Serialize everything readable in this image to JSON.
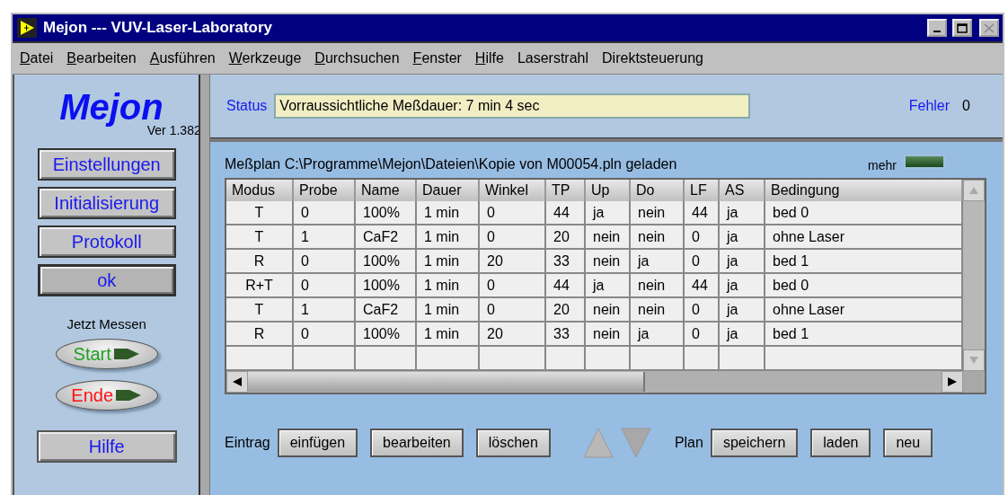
{
  "window": {
    "title": "Mejon --- VUV-Laser-Laboratory"
  },
  "menu": [
    {
      "label": "Datei",
      "mnemonic": true
    },
    {
      "label": "Bearbeiten",
      "mnemonic": true
    },
    {
      "label": "Ausführen",
      "mnemonic": true
    },
    {
      "label": "Werkzeuge",
      "mnemonic": true
    },
    {
      "label": "Durchsuchen",
      "mnemonic": true
    },
    {
      "label": "Fenster",
      "mnemonic": true
    },
    {
      "label": "Hilfe",
      "mnemonic": true
    },
    {
      "label": "Laserstrahl",
      "mnemonic": false
    },
    {
      "label": "Direktsteuerung",
      "mnemonic": false
    }
  ],
  "sidebar": {
    "logo": "Mejon",
    "version": "Ver 1.382",
    "buttons": [
      {
        "label": "Einstellungen",
        "pressed": false
      },
      {
        "label": "Initialisierung",
        "pressed": false
      },
      {
        "label": "Protokoll",
        "pressed": false
      },
      {
        "label": "ok",
        "pressed": true
      }
    ],
    "measure_label": "Jetzt Messen",
    "run_buttons": [
      {
        "label": "Start",
        "color": "#20a020"
      },
      {
        "label": "Ende",
        "color": "#ff1010"
      }
    ],
    "help_button": "Hilfe"
  },
  "status": {
    "label": "Status",
    "value": "Vorraussichtliche Meßdauer: 7 min 4 sec",
    "error_label": "Fehler",
    "error_value": "0"
  },
  "plan": {
    "caption": "Meßplan C:\\Programme\\Mejon\\Dateien\\Kopie von M00054.pln geladen",
    "more_label": "mehr",
    "more_on": false
  },
  "table": {
    "columns": [
      "Modus",
      "Probe",
      "Name",
      "Dauer",
      "Winkel",
      "TP",
      "Up",
      "Do",
      "LF",
      "AS",
      "Bedingung"
    ],
    "rows": [
      [
        "T",
        "0",
        "100%",
        "1 min",
        "0",
        "44",
        "ja",
        "nein",
        "44",
        "ja",
        "bed 0"
      ],
      [
        "T",
        "1",
        "CaF2",
        "1 min",
        "0",
        "20",
        "nein",
        "nein",
        "0",
        "ja",
        "ohne Laser"
      ],
      [
        "R",
        "0",
        "100%",
        "1 min",
        "20",
        "33",
        "nein",
        "ja",
        "0",
        "ja",
        "bed 1"
      ],
      [
        "R+T",
        "0",
        "100%",
        "1 min",
        "0",
        "44",
        "ja",
        "nein",
        "44",
        "ja",
        "bed 0"
      ],
      [
        "T",
        "1",
        "CaF2",
        "1 min",
        "0",
        "20",
        "nein",
        "nein",
        "0",
        "ja",
        "ohne Laser"
      ],
      [
        "R",
        "0",
        "100%",
        "1 min",
        "20",
        "33",
        "nein",
        "ja",
        "0",
        "ja",
        "bed 1"
      ]
    ]
  },
  "entry": {
    "label": "Eintrag",
    "buttons": [
      "einfügen",
      "bearbeiten",
      "löschen"
    ]
  },
  "plan_actions": {
    "label": "Plan",
    "buttons": [
      "speichern",
      "laden",
      "neu"
    ]
  }
}
